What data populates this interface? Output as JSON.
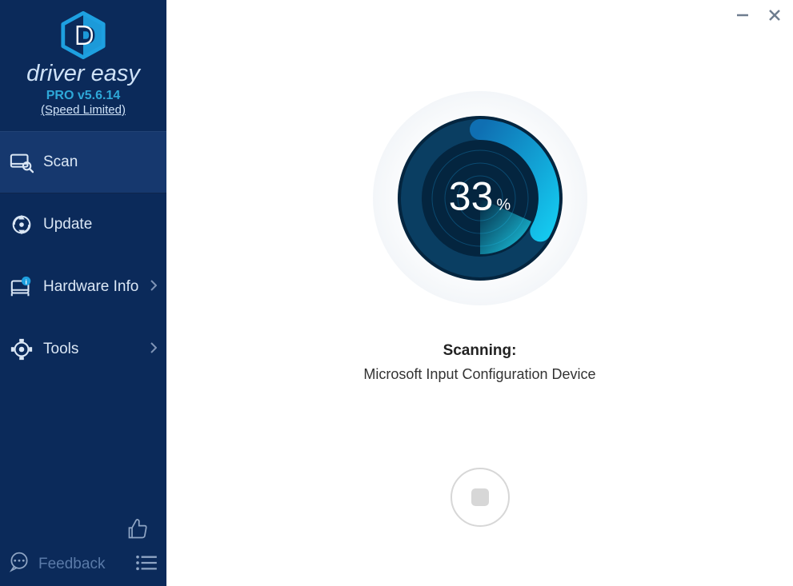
{
  "brand": {
    "name": "driver easy",
    "version": "PRO v5.6.14",
    "speed_limited": "(Speed Limited)"
  },
  "nav": {
    "scan": "Scan",
    "update": "Update",
    "hardware_info": "Hardware Info",
    "tools": "Tools"
  },
  "footer": {
    "feedback": "Feedback"
  },
  "scan": {
    "progress_value": "33",
    "progress_unit": "%",
    "status_label": "Scanning:",
    "current_item": "Microsoft Input Configuration Device"
  }
}
